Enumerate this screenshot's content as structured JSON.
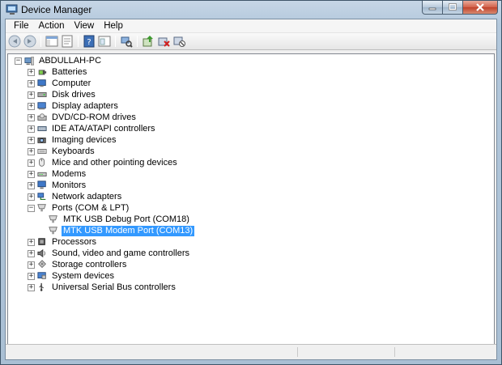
{
  "window": {
    "title": "Device Manager"
  },
  "menu": [
    "File",
    "Action",
    "View",
    "Help"
  ],
  "toolbar": [
    {
      "name": "back-icon"
    },
    {
      "name": "forward-icon"
    },
    {
      "sep": true
    },
    {
      "name": "show-hide-console-tree-icon"
    },
    {
      "name": "properties-sheet-icon"
    },
    {
      "sep": true
    },
    {
      "name": "help-icon"
    },
    {
      "name": "view-options-icon"
    },
    {
      "sep": true
    },
    {
      "name": "scan-hardware-changes-icon"
    },
    {
      "sep": true
    },
    {
      "name": "update-driver-icon"
    },
    {
      "name": "uninstall-device-icon"
    },
    {
      "name": "disable-device-icon"
    }
  ],
  "tree": {
    "root": "ABDULLAH-PC",
    "categories": [
      {
        "label": "Batteries",
        "icon": "battery-icon"
      },
      {
        "label": "Computer",
        "icon": "computer-icon"
      },
      {
        "label": "Disk drives",
        "icon": "disk-drive-icon"
      },
      {
        "label": "Display adapters",
        "icon": "display-adapter-icon"
      },
      {
        "label": "DVD/CD-ROM drives",
        "icon": "dvd-drive-icon"
      },
      {
        "label": "IDE ATA/ATAPI controllers",
        "icon": "ide-controller-icon"
      },
      {
        "label": "Imaging devices",
        "icon": "camera-icon"
      },
      {
        "label": "Keyboards",
        "icon": "keyboard-icon"
      },
      {
        "label": "Mice and other pointing devices",
        "icon": "mouse-icon"
      },
      {
        "label": "Modems",
        "icon": "modem-icon"
      },
      {
        "label": "Monitors",
        "icon": "monitor-icon"
      },
      {
        "label": "Network adapters",
        "icon": "network-adapter-icon"
      },
      {
        "label": "Ports (COM & LPT)",
        "icon": "port-icon",
        "expanded": true,
        "children": [
          {
            "label": "MTK USB Debug Port (COM18)",
            "icon": "port-icon"
          },
          {
            "label": "MTK USB Modem Port (COM13)",
            "icon": "port-icon",
            "selected": true
          }
        ]
      },
      {
        "label": "Processors",
        "icon": "processor-icon"
      },
      {
        "label": "Sound, video and game controllers",
        "icon": "speaker-icon"
      },
      {
        "label": "Storage controllers",
        "icon": "storage-controller-icon"
      },
      {
        "label": "System devices",
        "icon": "system-device-icon"
      },
      {
        "label": "Universal Serial Bus controllers",
        "icon": "usb-icon"
      }
    ]
  },
  "colors": {
    "selection": "#3399ff",
    "title_close": "#c0422b"
  }
}
